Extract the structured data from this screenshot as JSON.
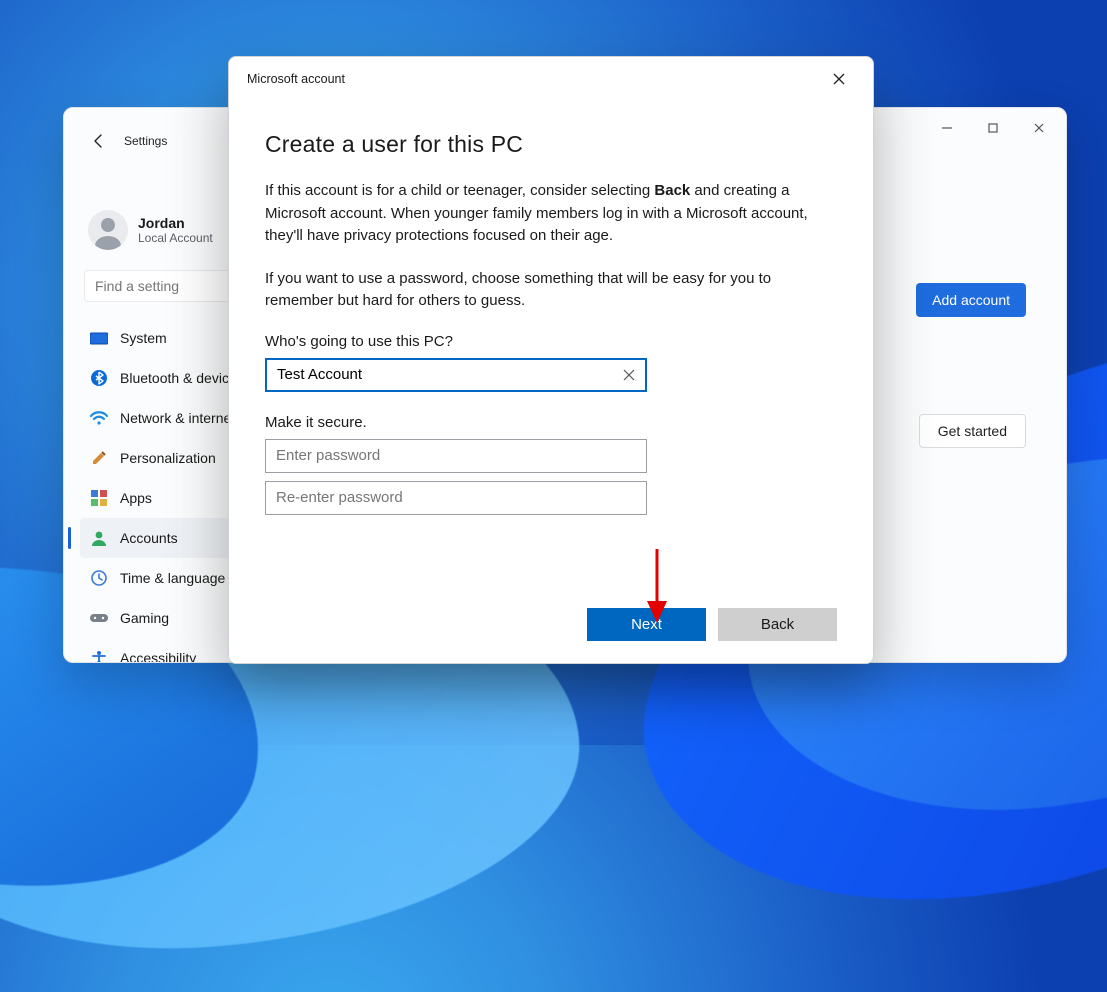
{
  "settings": {
    "header": "Settings",
    "user": {
      "name": "Jordan",
      "type": "Local Account"
    },
    "search": {
      "placeholder": "Find a setting"
    },
    "nav": [
      {
        "label": "System",
        "icon": "system"
      },
      {
        "label": "Bluetooth & devices",
        "icon": "bluetooth"
      },
      {
        "label": "Network & internet",
        "icon": "network"
      },
      {
        "label": "Personalization",
        "icon": "personalization"
      },
      {
        "label": "Apps",
        "icon": "apps"
      },
      {
        "label": "Accounts",
        "icon": "accounts",
        "selected": true
      },
      {
        "label": "Time & language",
        "icon": "time"
      },
      {
        "label": "Gaming",
        "icon": "gaming"
      },
      {
        "label": "Accessibility",
        "icon": "accessibility"
      }
    ],
    "buttons": {
      "add_account": "Add account",
      "get_started": "Get started"
    }
  },
  "dialog": {
    "window_title": "Microsoft account",
    "heading": "Create a user for this PC",
    "para1_a": "If this account is for a child or teenager, consider selecting ",
    "para1_bold": "Back",
    "para1_b": " and creating a Microsoft account. When younger family members log in with a Microsoft account, they'll have privacy protections focused on their age.",
    "para2": "If you want to use a password, choose something that will be easy for you to remember but hard for others to guess.",
    "q_label": "Who's going to use this PC?",
    "username_value": "Test Account",
    "secure_label": "Make it secure.",
    "pw_placeholder": "Enter password",
    "pw2_placeholder": "Re-enter password",
    "next": "Next",
    "back": "Back"
  }
}
